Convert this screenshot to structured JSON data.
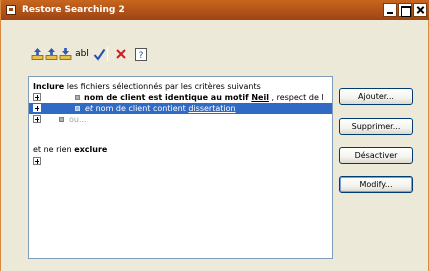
{
  "window": {
    "title": "Restore Searching 2"
  },
  "toolbar": {
    "tools": [
      {
        "icon": "add-criterion-icon"
      },
      {
        "icon": "add-criterion-before-icon"
      },
      {
        "icon": "add-criterion-after-icon"
      },
      {
        "icon": "text-field-icon",
        "label": "abl"
      },
      {
        "icon": "checkmark-icon"
      },
      {
        "icon": "delete-x-icon"
      },
      {
        "icon": "help-icon"
      }
    ]
  },
  "criteria": {
    "include_keyword": "Inclure",
    "include_rest": " les fichiers sélectionnés par les critères suivants",
    "row1": {
      "bold_text": "nom de client est identique au motif ",
      "value": "Neil",
      "rest": " , respect de l"
    },
    "row2": {
      "prefix": "et",
      "text": " nom de client contient ",
      "value": "dissertation"
    },
    "row3": {
      "text": "ou..."
    },
    "exclude_prefix": "et ne rien ",
    "exclude_keyword": "exclure"
  },
  "buttons": {
    "add": "Ajouter...",
    "delete": "Supprimer...",
    "deactivate": "Désactiver",
    "modify": "Modify..."
  },
  "colors": {
    "titlebar": "#b1531a",
    "selection": "#316ac5",
    "background": "#ece9d8"
  }
}
